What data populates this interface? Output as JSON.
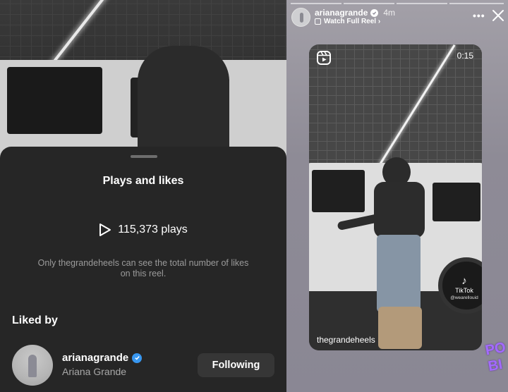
{
  "left_panel": {
    "sheet": {
      "title": "Plays and likes",
      "plays_text": "115,373 plays",
      "note": "Only thegrandeheels can see the total number of likes on this reel.",
      "liked_by_label": "Liked by",
      "liker": {
        "username": "arianagrande",
        "full_name": "Ariana Grande",
        "button_label": "Following"
      }
    }
  },
  "right_panel": {
    "progress_segments": 4,
    "story": {
      "username": "arianagrande",
      "time": "4m",
      "watch_full_label": "Watch Full Reel ›",
      "more_label": "•••"
    },
    "reel": {
      "duration": "0:15",
      "watermark": "TikTok",
      "watermark_handle": "@wearellouid",
      "username": "thegrandeheels"
    }
  },
  "colors": {
    "sheet_bg": "#262626",
    "verified_blue": "#3897f0",
    "button_bg": "#363636",
    "note_text": "#9b9b9b"
  },
  "icons": [
    "play-icon",
    "verified-icon",
    "more-icon",
    "close-icon",
    "reel-icon",
    "tiktok-icon"
  ]
}
